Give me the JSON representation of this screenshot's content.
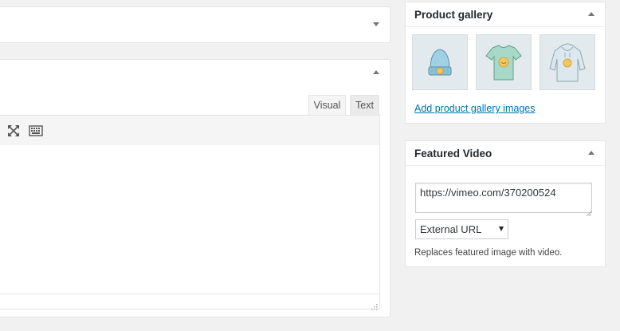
{
  "editor": {
    "tab_visual": "Visual",
    "tab_text": "Text",
    "toolbar": [
      {
        "icon": "fullscreen-icon"
      },
      {
        "icon": "toolbar-toggle-icon"
      }
    ]
  },
  "product_gallery": {
    "title": "Product gallery",
    "images": [
      {
        "icon": "beanie-thumbnail"
      },
      {
        "icon": "tshirt-thumbnail"
      },
      {
        "icon": "hoodie-thumbnail"
      }
    ],
    "add_link": "Add product gallery images"
  },
  "featured_video": {
    "title": "Featured Video",
    "url_value": "https://vimeo.com/370200524",
    "source_selected": "External URL",
    "description": "Replaces featured image with video."
  },
  "colors": {
    "link": "#0073aa",
    "thumb_bg": "#e3eaee",
    "product_teal": "#a8d8c8",
    "product_blue": "#9fd0e6",
    "badge": "#f5c85a"
  }
}
